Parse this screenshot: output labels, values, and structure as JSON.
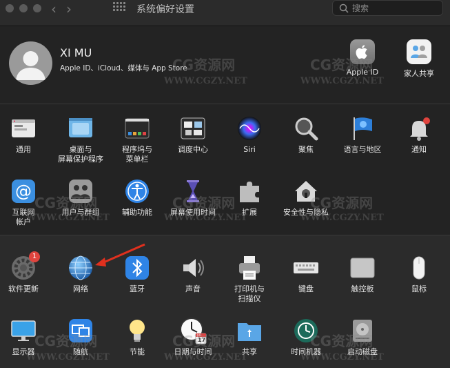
{
  "window": {
    "title": "系统偏好设置",
    "search_placeholder": "搜索"
  },
  "account": {
    "name": "XI MU",
    "subtitle": "Apple ID、iCloud、媒体与 App Store",
    "apple_id_label": "Apple ID",
    "family_label": "家人共享"
  },
  "row1": [
    {
      "label": "通用"
    },
    {
      "label": "桌面与\n屏幕保护程序"
    },
    {
      "label": "程序坞与\n菜单栏"
    },
    {
      "label": "调度中心"
    },
    {
      "label": "Siri"
    },
    {
      "label": "聚焦"
    },
    {
      "label": "语言与地区"
    },
    {
      "label": "通知"
    }
  ],
  "row2": [
    {
      "label": "互联网\n帐户"
    },
    {
      "label": "用户与群组"
    },
    {
      "label": "辅助功能"
    },
    {
      "label": "屏幕使用时间"
    },
    {
      "label": "扩展"
    },
    {
      "label": "安全性与隐私"
    }
  ],
  "row3": [
    {
      "label": "软件更新",
      "badge": "1"
    },
    {
      "label": "网络"
    },
    {
      "label": "蓝牙"
    },
    {
      "label": "声音"
    },
    {
      "label": "打印机与\n扫描仪"
    },
    {
      "label": "键盘"
    },
    {
      "label": "触控板"
    },
    {
      "label": "鼠标"
    }
  ],
  "row4": [
    {
      "label": "显示器"
    },
    {
      "label": "随航"
    },
    {
      "label": "节能"
    },
    {
      "label": "日期与时间"
    },
    {
      "label": "共享"
    },
    {
      "label": "时间机器"
    },
    {
      "label": "启动磁盘"
    }
  ],
  "calendar": {
    "month": "JUL",
    "day": "17"
  },
  "watermark": {
    "text": "CG资源网",
    "url": "WWW.CGZY.NET"
  },
  "colors": {
    "background": "#232323",
    "band": "#2b2b2b",
    "badge": "#e0443e",
    "arrow": "#e0301e"
  }
}
